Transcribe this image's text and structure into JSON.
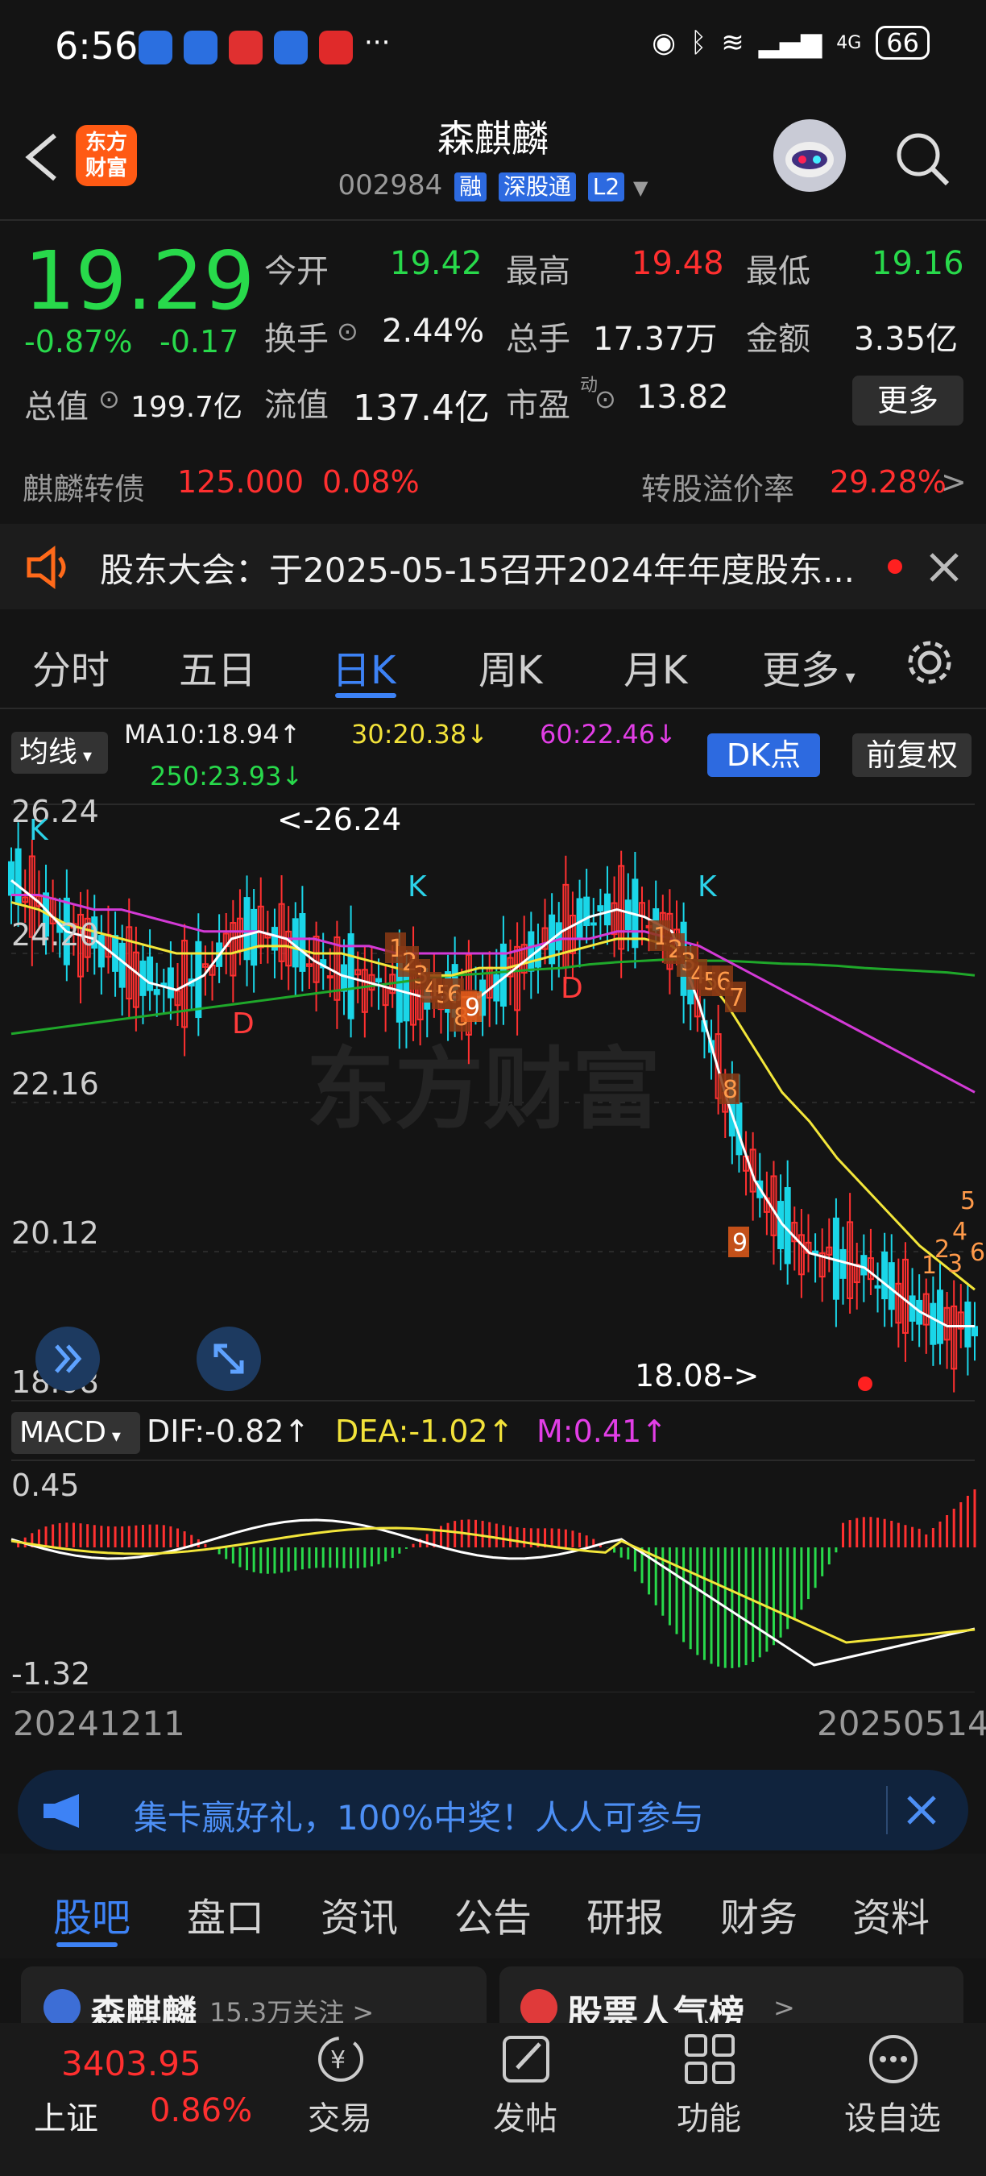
{
  "status_bar": {
    "time": "6:56",
    "battery": "66",
    "network": "4G"
  },
  "header": {
    "title": "森麒麟",
    "code": "002984",
    "tags": [
      "融",
      "深股通",
      "L2"
    ],
    "logo_text": "东方财富"
  },
  "quote": {
    "price": "19.29",
    "change_pct": "-0.87%",
    "change": "-0.17",
    "open_label": "今开",
    "open": "19.42",
    "high_label": "最高",
    "high": "19.48",
    "low_label": "最低",
    "low": "19.16",
    "turnover_label": "换手",
    "turnover": "2.44%",
    "volume_label": "总手",
    "volume": "17.37万",
    "amount_label": "金额",
    "amount": "3.35亿",
    "mktcap_label": "总值",
    "mktcap": "199.7亿",
    "float_label": "流值",
    "float": "137.4亿",
    "pe_label": "市盈",
    "pe_sup": "动",
    "pe": "13.82",
    "more_label": "更多"
  },
  "bond": {
    "name": "麒麟转债",
    "price": "125.000",
    "pct": "0.08%",
    "premium_label": "转股溢价率",
    "premium": "29.28%"
  },
  "notice": {
    "text": "股东大会：于2025-05-15召开2024年年度股东..."
  },
  "tabs": [
    "分时",
    "五日",
    "日K",
    "周K",
    "月K",
    "更多"
  ],
  "active_tab": "日K",
  "indicators": {
    "ma_select": "均线",
    "ma10": "MA10:18.94↑",
    "ma30": "30:20.38↓",
    "ma60": "60:22.46↓",
    "ma250": "250:23.93↓",
    "dk_label": "DK点",
    "adjust_label": "前复权"
  },
  "chart_data": {
    "type": "candlestick",
    "y_ticks": [
      "26.24",
      "24.20",
      "22.16",
      "20.12",
      "18.08"
    ],
    "max_label": "<-26.24",
    "min_label": "18.08->",
    "watermark": "东方财富",
    "signals_k": [
      "K",
      "K",
      "K"
    ],
    "signals_d": [
      "D",
      "D"
    ],
    "seq_numbers": [
      "1",
      "2",
      "3",
      "4",
      "5",
      "6",
      "7",
      "8",
      "9"
    ],
    "colors": {
      "up": "#ff3030",
      "down": "#1ad6e8",
      "ma10": "#ffffff",
      "ma30": "#f3e63a",
      "ma60": "#d33ad6",
      "ma250": "#1fa82a"
    },
    "ma10": [
      25.2,
      24.9,
      24.5,
      24.4,
      24.1,
      23.8,
      23.7,
      23.9,
      24.4,
      24.5,
      24.4,
      24.1,
      23.9,
      23.8,
      23.7,
      23.6,
      23.6,
      23.6,
      23.9,
      24.2,
      24.5,
      24.7,
      24.8,
      24.7,
      24.5,
      23.5,
      22.2,
      21.1,
      20.5,
      20.1,
      20.0,
      19.9,
      19.6,
      19.3,
      19.1,
      19.1
    ],
    "ma30": [
      24.9,
      24.8,
      24.6,
      24.5,
      24.4,
      24.3,
      24.2,
      24.2,
      24.2,
      24.3,
      24.3,
      24.2,
      24.2,
      24.1,
      24.0,
      23.9,
      23.9,
      24.0,
      24.0,
      24.1,
      24.2,
      24.3,
      24.4,
      24.4,
      24.3,
      24.0,
      23.5,
      22.9,
      22.3,
      21.9,
      21.4,
      21.0,
      20.6,
      20.2,
      19.9,
      19.6
    ],
    "ma60": [
      25.0,
      25.0,
      24.9,
      24.8,
      24.8,
      24.7,
      24.6,
      24.5,
      24.5,
      24.5,
      24.4,
      24.4,
      24.3,
      24.3,
      24.2,
      24.2,
      24.2,
      24.2,
      24.2,
      24.3,
      24.4,
      24.4,
      24.5,
      24.5,
      24.4,
      24.3,
      24.1,
      23.9,
      23.7,
      23.5,
      23.3,
      23.1,
      22.9,
      22.7,
      22.5,
      22.3
    ],
    "ma250": [
      23.1,
      23.15,
      23.2,
      23.25,
      23.3,
      23.35,
      23.4,
      23.45,
      23.5,
      23.55,
      23.6,
      23.65,
      23.7,
      23.75,
      23.8,
      23.85,
      23.9,
      23.92,
      23.95,
      23.98,
      24.0,
      24.05,
      24.08,
      24.1,
      24.12,
      24.1,
      24.1,
      24.08,
      24.06,
      24.05,
      24.03,
      24.0,
      23.98,
      23.96,
      23.94,
      23.9
    ]
  },
  "macd": {
    "label": "MACD",
    "dif": "DIF:-0.82↑",
    "dea": "DEA:-1.02↑",
    "m": "M:0.41↑",
    "y_top": "0.45",
    "y_bottom": "-1.32",
    "x_start": "20241211",
    "x_end": "20250514"
  },
  "promo": {
    "text": "集卡赢好礼，100%中奖！人人可参与"
  },
  "bottom_tabs": [
    "股吧",
    "盘口",
    "资讯",
    "公告",
    "研报",
    "财务",
    "资料"
  ],
  "active_bottom_tab": "股吧",
  "cards": [
    {
      "title": "森麒麟",
      "sub": "15.3万关注 >"
    },
    {
      "title": "股票人气榜",
      "sub": ">"
    }
  ],
  "navbar": {
    "index_value": "3403.95",
    "index_name": "上证",
    "index_pct": "0.86%",
    "items": [
      "交易",
      "发帖",
      "功能",
      "设自选"
    ]
  }
}
